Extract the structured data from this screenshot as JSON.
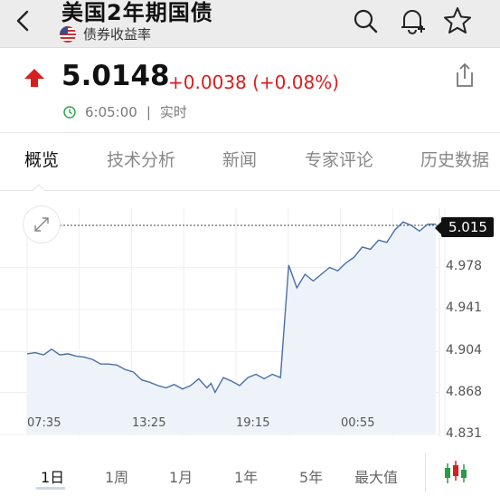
{
  "header": {
    "title": "美国2年期国债",
    "subtitle": "债券收益率"
  },
  "quote": {
    "price": "5.0148",
    "change": "+0.0038 (+0.08%)",
    "time": "6:05:00",
    "separator": "|",
    "status": "实时"
  },
  "tabs": [
    "概览",
    "技术分析",
    "新闻",
    "专家评论",
    "历史数据"
  ],
  "chart": {
    "current_label": "5.015",
    "y_ticks": [
      "4.978",
      "4.941",
      "4.904",
      "4.868",
      "4.831"
    ],
    "x_ticks": [
      "07:35",
      "13:25",
      "19:15",
      "00:55"
    ]
  },
  "periods": [
    "1日",
    "1周",
    "1月",
    "1年",
    "5年",
    "最大值"
  ],
  "colors": {
    "up": "#d81e1e",
    "line": "#4a6fa5",
    "fill": "#eef3fa"
  },
  "chart_data": {
    "type": "area",
    "x": [
      0,
      2,
      4,
      6,
      8,
      10,
      12,
      14,
      16,
      18,
      20,
      22,
      24,
      26,
      28,
      30,
      32,
      34,
      36,
      38,
      40,
      42,
      44,
      45,
      46,
      48,
      50,
      52,
      54,
      56,
      58,
      60,
      62,
      64,
      66,
      68,
      70,
      72,
      74,
      76,
      78,
      80,
      82,
      84,
      86,
      88,
      90,
      92,
      94,
      96,
      98,
      100
    ],
    "y": [
      4.902,
      4.903,
      4.901,
      4.906,
      4.901,
      4.902,
      4.9,
      4.899,
      4.897,
      4.893,
      4.893,
      4.892,
      4.888,
      4.886,
      4.879,
      4.877,
      4.874,
      4.872,
      4.875,
      4.871,
      4.874,
      4.88,
      4.872,
      4.876,
      4.868,
      4.881,
      4.878,
      4.874,
      4.881,
      4.884,
      4.88,
      4.884,
      4.881,
      4.98,
      4.96,
      4.972,
      4.966,
      4.972,
      4.978,
      4.975,
      4.982,
      4.987,
      4.996,
      4.994,
      5.002,
      5.0,
      5.011,
      5.018,
      5.015,
      5.01,
      5.016,
      5.016
    ],
    "x_ticks": [
      "07:35",
      "13:25",
      "19:15",
      "00:55"
    ],
    "y_ticks": [
      4.831,
      4.868,
      4.904,
      4.941,
      4.978
    ],
    "ylim": [
      4.831,
      5.015
    ],
    "current": 5.015,
    "grid": true
  }
}
